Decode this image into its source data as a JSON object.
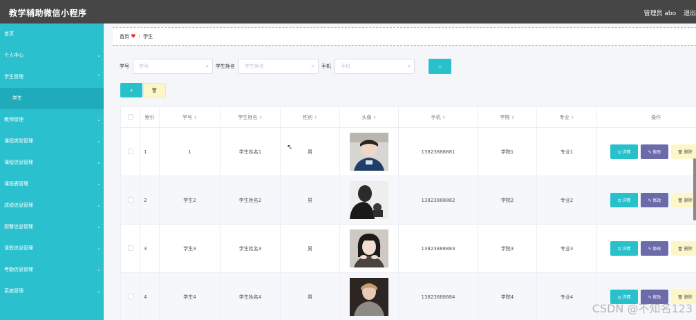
{
  "app": {
    "title": "教学辅助微信小程序"
  },
  "user": {
    "role": "管理员 abo",
    "logout": "退出"
  },
  "sidebar": {
    "items": [
      {
        "label": "首页",
        "chevron": false
      },
      {
        "label": "个人中心",
        "chevron": true
      },
      {
        "label": "学生管理",
        "chevron": true,
        "expanded": true
      },
      {
        "label": "学生",
        "chevron": false,
        "sub": true
      },
      {
        "label": "教师管理",
        "chevron": true
      },
      {
        "label": "课程类型管理",
        "chevron": true
      },
      {
        "label": "课程信息管理",
        "chevron": true
      },
      {
        "label": "课程表管理",
        "chevron": true
      },
      {
        "label": "成绩信息管理",
        "chevron": true
      },
      {
        "label": "预警信息管理",
        "chevron": true
      },
      {
        "label": "请假信息管理",
        "chevron": true
      },
      {
        "label": "考勤信息管理",
        "chevron": true
      },
      {
        "label": "系统管理",
        "chevron": true
      }
    ]
  },
  "breadcrumb": {
    "home": "首页",
    "current": "学生"
  },
  "search": {
    "fields": [
      {
        "label": "学号",
        "placeholder": "学号"
      },
      {
        "label": "学生姓名",
        "placeholder": "学生姓名"
      },
      {
        "label": "手机",
        "placeholder": "手机"
      }
    ]
  },
  "actions": {
    "add": "+",
    "delete": "🗑"
  },
  "table": {
    "columns": [
      "索引",
      "学号",
      "学生姓名",
      "性别",
      "头像",
      "手机",
      "学院",
      "专业",
      "操作"
    ],
    "rows": [
      {
        "index": "1",
        "student_no": "1",
        "name": "学生姓名1",
        "gender": "男",
        "phone": "13823888881",
        "college": "学院1",
        "major": "专业1"
      },
      {
        "index": "2",
        "student_no": "学生2",
        "name": "学生姓名2",
        "gender": "男",
        "phone": "13823888882",
        "college": "学院2",
        "major": "专业2"
      },
      {
        "index": "3",
        "student_no": "学生3",
        "name": "学生姓名3",
        "gender": "男",
        "phone": "13823888883",
        "college": "学院3",
        "major": "专业3"
      },
      {
        "index": "4",
        "student_no": "学生4",
        "name": "学生姓名4",
        "gender": "男",
        "phone": "13823888884",
        "college": "学院4",
        "major": "专业4"
      }
    ],
    "ops": {
      "view": "详情",
      "edit": "修改",
      "del": "删除"
    }
  },
  "watermark": "CSDN @不知名123",
  "colors": {
    "accent": "#27c0cb",
    "sidebar": "#2bc0ce",
    "topbar": "#464646",
    "edit": "#6a6ba8",
    "delete": "#fdf6c8"
  }
}
